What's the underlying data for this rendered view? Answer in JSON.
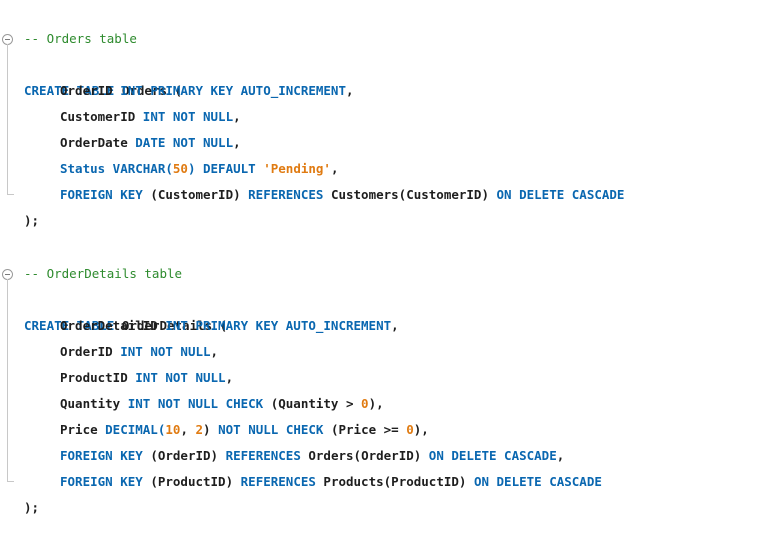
{
  "editor": {
    "block1": {
      "comment": "-- Orders table",
      "l1": {
        "kw1": "CREATE TABLE",
        "name": " Orders ("
      },
      "l2": {
        "a": "OrderID ",
        "b": "INT PRIMARY KEY AUTO_INCREMENT",
        "c": ","
      },
      "l3": {
        "a": "CustomerID ",
        "b": "INT NOT NULL",
        "c": ","
      },
      "l4": {
        "a": "OrderDate ",
        "b": "DATE NOT NULL",
        "c": ","
      },
      "l5": {
        "a": "Status VARCHAR(",
        "n": "50",
        "b": ") DEFAULT ",
        "s": "'Pending'",
        "c": ","
      },
      "l6": {
        "k1": "FOREIGN KEY",
        "a": " (CustomerID) ",
        "k2": "REFERENCES",
        "b": " Customers(CustomerID) ",
        "k3": "ON DELETE CASCADE"
      },
      "close": ");"
    },
    "block2": {
      "comment": "-- OrderDetails table",
      "l1": {
        "kw1": "CREATE TABLE",
        "name": " OrderDetails ("
      },
      "l2": {
        "a": "OrderDetailID ",
        "b": "INT PRIMARY KEY AUTO_INCREMENT",
        "c": ","
      },
      "l3": {
        "a": "OrderID ",
        "b": "INT NOT NULL",
        "c": ","
      },
      "l4": {
        "a": "ProductID ",
        "b": "INT NOT NULL",
        "c": ","
      },
      "l5": {
        "a": "Quantity ",
        "b": "INT NOT NULL CHECK",
        "c": " (Quantity > ",
        "n": "0",
        "d": "),"
      },
      "l6": {
        "a": "Price ",
        "b": "DECIMAL(",
        "n1": "10",
        "c": ", ",
        "n2": "2",
        "d": ") ",
        "e": "NOT NULL CHECK",
        "f": " (Price >= ",
        "n3": "0",
        "g": "),"
      },
      "l7": {
        "k1": "FOREIGN KEY",
        "a": " (OrderID) ",
        "k2": "REFERENCES",
        "b": " Orders(OrderID) ",
        "k3": "ON DELETE CASCADE",
        "c": ","
      },
      "l8": {
        "k1": "FOREIGN KEY",
        "a": " (ProductID) ",
        "k2": "REFERENCES",
        "b": " Products(ProductID) ",
        "k3": "ON DELETE CASCADE"
      },
      "close": ");"
    }
  }
}
